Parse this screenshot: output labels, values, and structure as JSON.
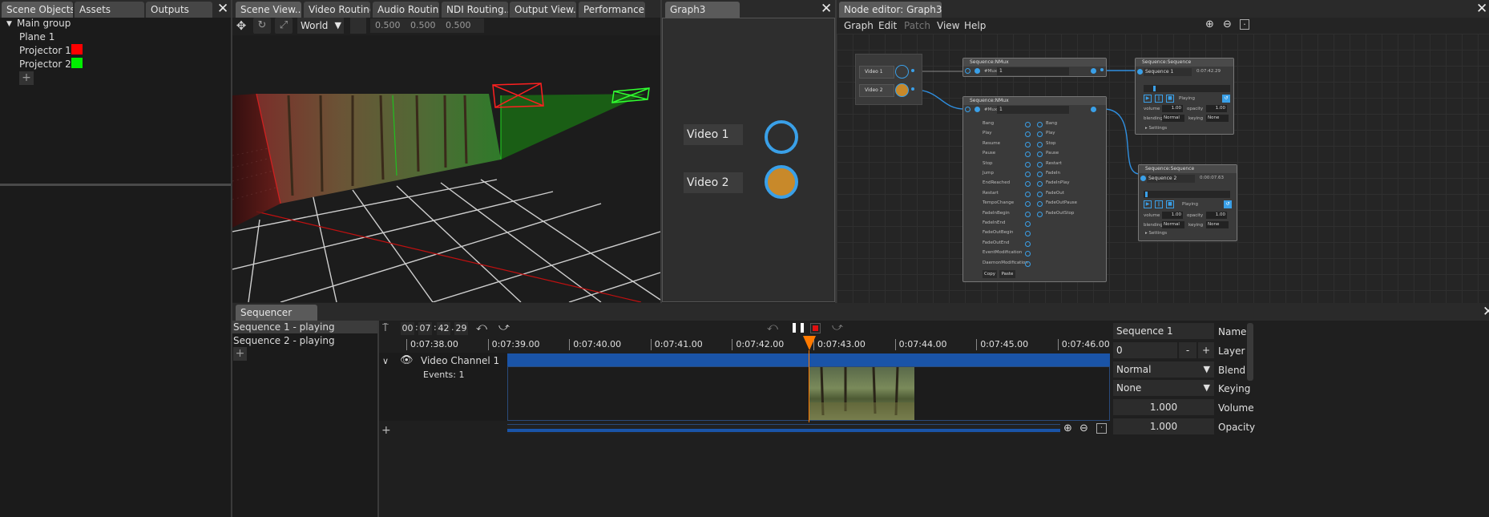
{
  "left_tabs": [
    "Scene Objects...",
    "Assets",
    "Outputs"
  ],
  "scene_tree": {
    "group": "Main group",
    "items": [
      {
        "label": "Plane 1",
        "color": ""
      },
      {
        "label": "Projector 1",
        "color": "#ff0000"
      },
      {
        "label": "Projector 2",
        "color": "#00ee00"
      }
    ]
  },
  "center_tabs": [
    "Scene View...",
    "Video Routing...",
    "Audio Routing...",
    "NDI Routing...",
    "Output View...",
    "Performance O..."
  ],
  "scene_toolbar": {
    "space": "World",
    "values": [
      "0.500",
      "0.500",
      "0.500"
    ]
  },
  "graph_panel": {
    "tab": "Graph3",
    "videos": [
      {
        "label": "Video 1",
        "filled": false
      },
      {
        "label": "Video 2",
        "filled": true
      }
    ]
  },
  "node_editor": {
    "tab": "Node editor: Graph3",
    "menu": [
      "Graph",
      "Edit",
      "Patch",
      "View",
      "Help"
    ],
    "colors": {
      "accent": "#3aa0e8",
      "fill": "#c8892a",
      "wire": "#2f8fe0"
    },
    "input_node": {
      "labels": [
        "Video 1",
        "Video 2"
      ]
    },
    "mux1": {
      "title": "Sequence:NMux",
      "field_label": "#Mux",
      "field_value": "1"
    },
    "mux2": {
      "title": "Sequence:NMux",
      "field_label": "#Mux",
      "field_value": "1",
      "left_labels": [
        "Bang",
        "Play",
        "Resume",
        "Pause",
        "Stop",
        "Jump",
        "EndReached",
        "Restart",
        "TempoChange",
        "FadeInBegin",
        "FadeInEnd",
        "FadeOutBegin",
        "FadeOutEnd",
        "EventModification",
        "DaemonModification"
      ],
      "right_labels": [
        "Bang",
        "Play",
        "Stop",
        "Pause",
        "Restart",
        "FadeIn",
        "FadeInPlay",
        "FadeOut",
        "FadeOutPause",
        "FadeOutStop"
      ],
      "buttons": [
        "Copy",
        "Paste"
      ]
    },
    "seq1": {
      "title": "Sequence:Sequence",
      "name": "Sequence 1",
      "time": "0:07:42.29",
      "state": "Playing",
      "volume": "1.00",
      "opacity": "1.00",
      "blending": "Normal",
      "keying": "None",
      "settings": "Settings"
    },
    "seq2": {
      "title": "Sequence:Sequence",
      "name": "Sequence 2",
      "time": "0:00:07.63",
      "state": "Playing",
      "volume": "1.00",
      "opacity": "1.00",
      "blending": "Normal",
      "keying": "None",
      "settings": "Settings"
    },
    "field_labels": {
      "volume": "volume",
      "opacity": "opacity",
      "blending": "blending",
      "keying": "keying"
    }
  },
  "sequencer": {
    "tab": "Sequencer",
    "sequences": [
      "Sequence 1 - playing",
      "Sequence 2 - playing"
    ],
    "timecode": [
      "00",
      "07",
      "42",
      "29"
    ],
    "ruler": [
      "0:07:38.00",
      "0:07:39.00",
      "0:07:40.00",
      "0:07:41.00",
      "0:07:42.00",
      "0:07:43.00",
      "0:07:44.00",
      "0:07:45.00",
      "0:07:46.00"
    ],
    "channel": {
      "name": "Video Channel 1",
      "events": "Events: 1"
    },
    "playhead_color": "#ff7a00",
    "props": {
      "name_value": "Sequence 1",
      "name_label": "Name",
      "layer_value": "0",
      "layer_label": "Layer",
      "layer_minus": "-",
      "layer_plus": "+",
      "blend_value": "Normal",
      "blend_label": "Blend",
      "keying_value": "None",
      "keying_label": "Keying",
      "volume_value": "1.000",
      "volume_label": "Volume",
      "opacity_value": "1.000",
      "opacity_label": "Opacity"
    }
  }
}
